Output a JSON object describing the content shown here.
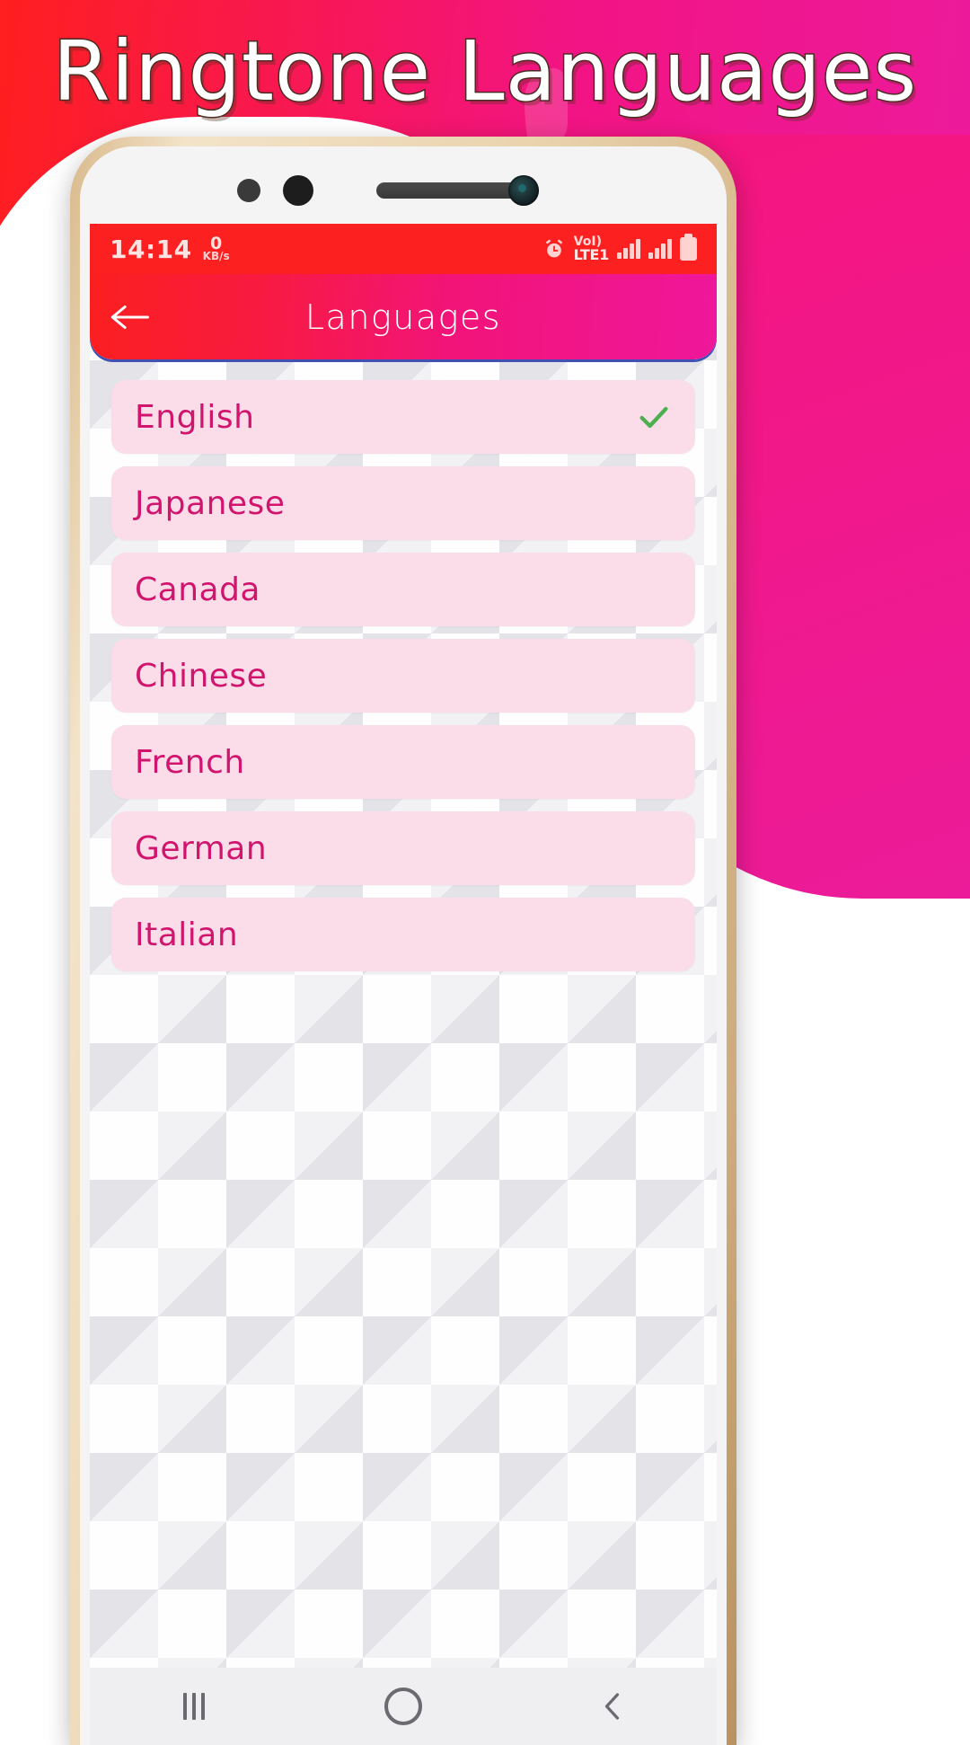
{
  "promo": {
    "title": "Ringtone Languages",
    "background_gradient_from": "#ff1e1e",
    "background_gradient_to": "#e81f9c",
    "watermark_icon": "phone-handset-icon"
  },
  "device": {
    "frame_color": "#e9d3ad",
    "sensors": [
      "proximity-sensor",
      "light-sensor",
      "earpiece-speaker",
      "front-camera"
    ]
  },
  "status_bar": {
    "time": "14:14",
    "network_speed_value": "0",
    "network_speed_unit": "KB/s",
    "alarm_icon": "alarm-clock-icon",
    "volte_line1": "VoI)",
    "volte_line2": "LTE1",
    "signal_icon_1": "signal-bars-icon",
    "signal_icon_2": "signal-bars-icon",
    "battery_icon": "battery-icon",
    "background_color": "#fc2020"
  },
  "app_bar": {
    "title": "Languages",
    "back_icon": "arrow-left-icon",
    "gradient_from": "#fb1f1f",
    "gradient_to": "#ef179b",
    "underline_color": "#3f51b5"
  },
  "languages": {
    "row_bg": "#fadde9",
    "text_color": "#d1156e",
    "check_color": "#4caf50",
    "items": [
      {
        "label": "English",
        "selected": true
      },
      {
        "label": "Japanese",
        "selected": false
      },
      {
        "label": "Canada",
        "selected": false
      },
      {
        "label": "Chinese",
        "selected": false
      },
      {
        "label": "French",
        "selected": false
      },
      {
        "label": "German",
        "selected": false
      },
      {
        "label": "Italian",
        "selected": false
      }
    ]
  },
  "nav_bar": {
    "recents_icon": "recents-icon",
    "home_icon": "home-circle-icon",
    "back_icon": "back-chevron-icon",
    "background_color": "#efeff1"
  }
}
